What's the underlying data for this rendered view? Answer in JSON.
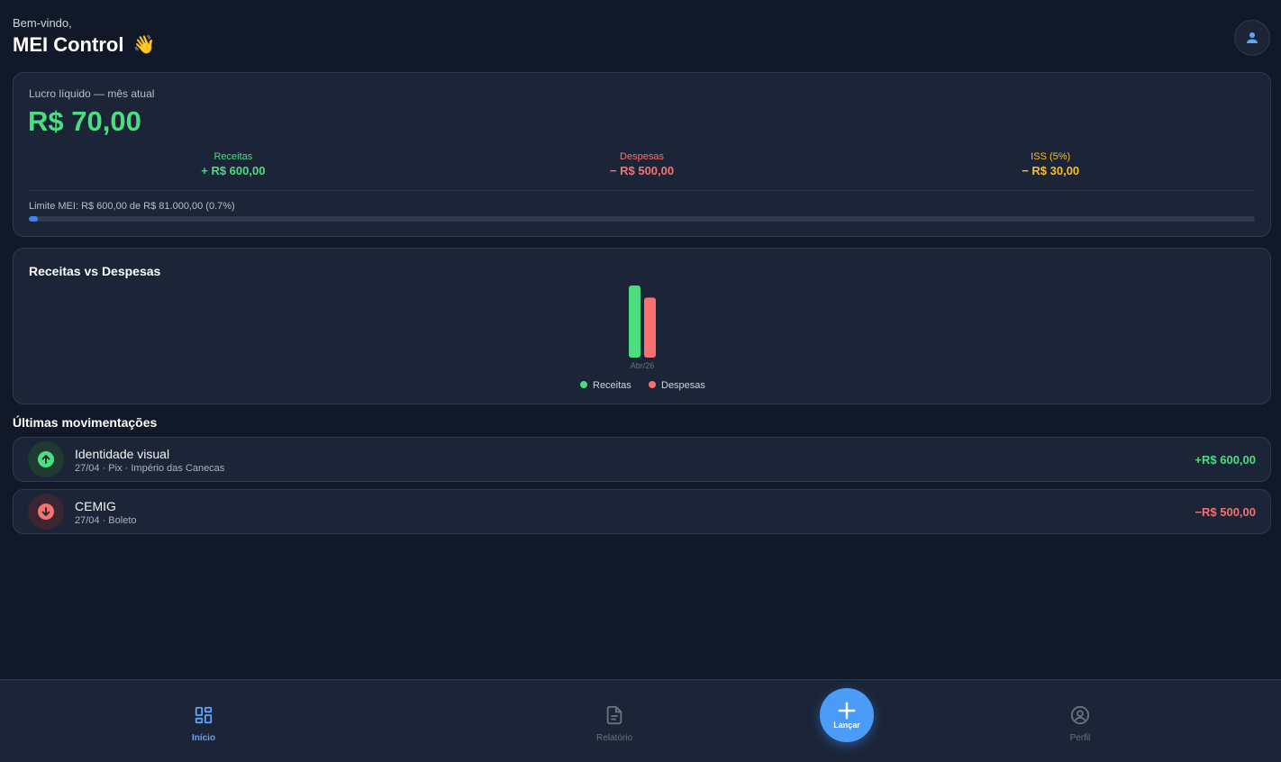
{
  "header": {
    "greeting": "Bem-vindo,",
    "title": "MEI Control",
    "emoji": "👋",
    "avatar_icon": "user-icon"
  },
  "summary": {
    "label": "Lucro líquido — mês atual",
    "net_profit": "R$ 70,00",
    "stats": [
      {
        "label": "Receitas",
        "value": "+ R$ 600,00",
        "color": "#4ade80"
      },
      {
        "label": "Despesas",
        "value": "− R$ 500,00",
        "color": "#f87171"
      },
      {
        "label": "ISS (5%)",
        "value": "− R$ 30,00",
        "color": "#fbbf24"
      }
    ],
    "limit_text": "Limite MEI: R$ 600,00 de R$ 81.000,00  (0.7%)",
    "limit_fraction": 0.007
  },
  "chart": {
    "title": "Receitas vs Despesas"
  },
  "chart_data": {
    "type": "bar",
    "categories": [
      "Abr/26"
    ],
    "series": [
      {
        "name": "Receitas",
        "values": [
          600
        ],
        "color": "#4ade80"
      },
      {
        "name": "Despesas",
        "values": [
          500
        ],
        "color": "#f87171"
      }
    ],
    "ylim": [
      0,
      600
    ],
    "legend": "bottom-center",
    "grid": false
  },
  "transactions": {
    "title": "Últimas movimentações",
    "items": [
      {
        "name": "Identidade visual",
        "meta": "27/04 · Pix · Império das Canecas",
        "amount": "+R$ 600,00",
        "type": "in",
        "icon": "arrow-up-icon"
      },
      {
        "name": "CEMIG",
        "meta": "27/04 · Boleto",
        "amount": "−R$ 500,00",
        "type": "out",
        "icon": "arrow-down-icon"
      }
    ]
  },
  "nav": {
    "home": "Início",
    "report": "Relatório",
    "add": "Lançar",
    "profile": "Perfil",
    "accent": "#60a5fa"
  }
}
